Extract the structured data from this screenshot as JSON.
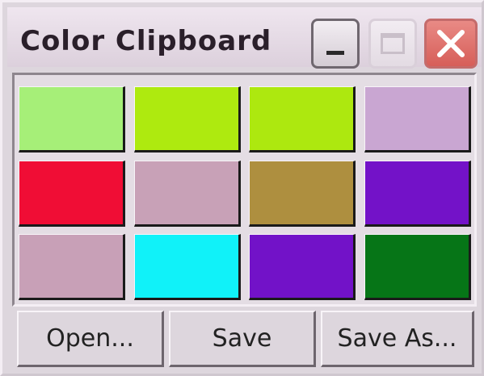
{
  "window": {
    "title": "Color Clipboard"
  },
  "swatches": [
    {
      "color": "#a6ef78"
    },
    {
      "color": "#aeea0f"
    },
    {
      "color": "#ade80f"
    },
    {
      "color": "#c9a6d2"
    },
    {
      "color": "#f00d35"
    },
    {
      "color": "#c8a1b7"
    },
    {
      "color": "#ae8f3f"
    },
    {
      "color": "#7312c8"
    },
    {
      "color": "#c8a0b7"
    },
    {
      "color": "#10f2f9"
    },
    {
      "color": "#7212c8"
    },
    {
      "color": "#067517"
    }
  ],
  "buttons": {
    "open": "Open...",
    "save": "Save",
    "save_as": "Save As..."
  }
}
